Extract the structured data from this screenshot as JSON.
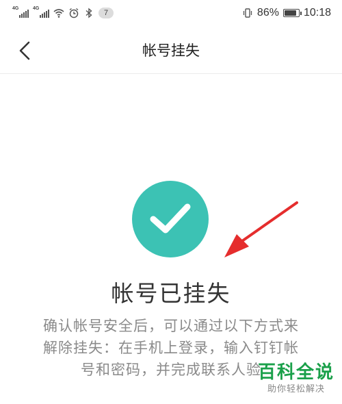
{
  "status_bar": {
    "network_1": "4G",
    "network_2": "4G",
    "notification_count": "7",
    "battery_percent": "86%",
    "battery_level": 0.86,
    "time": "10:18",
    "icons": [
      "signal-icon",
      "signal-icon",
      "wifi-icon",
      "alarm-icon",
      "bluetooth-icon",
      "vibrate-icon",
      "battery-icon"
    ]
  },
  "nav": {
    "back_icon": "chevron-left-icon",
    "title": "帐号挂失"
  },
  "main": {
    "success_icon": "checkmark-icon",
    "status_title": "帐号已挂失",
    "description_lines": [
      "确认帐号安全后，可以通过以下方式来",
      "解除挂失：在手机上登录，输入钉钉帐",
      "号和密码，并完成联系人验"
    ]
  },
  "annotation": {
    "arrow_icon": "red-arrow-icon",
    "arrow_color": "#e52d2d"
  },
  "watermark": {
    "brand": "百科全说",
    "tagline": "助你轻松解决"
  },
  "colors": {
    "accent": "#3cc2b4",
    "title_text": "#333333",
    "desc_text": "#8a8a8a",
    "watermark_green": "#1aa04a"
  }
}
